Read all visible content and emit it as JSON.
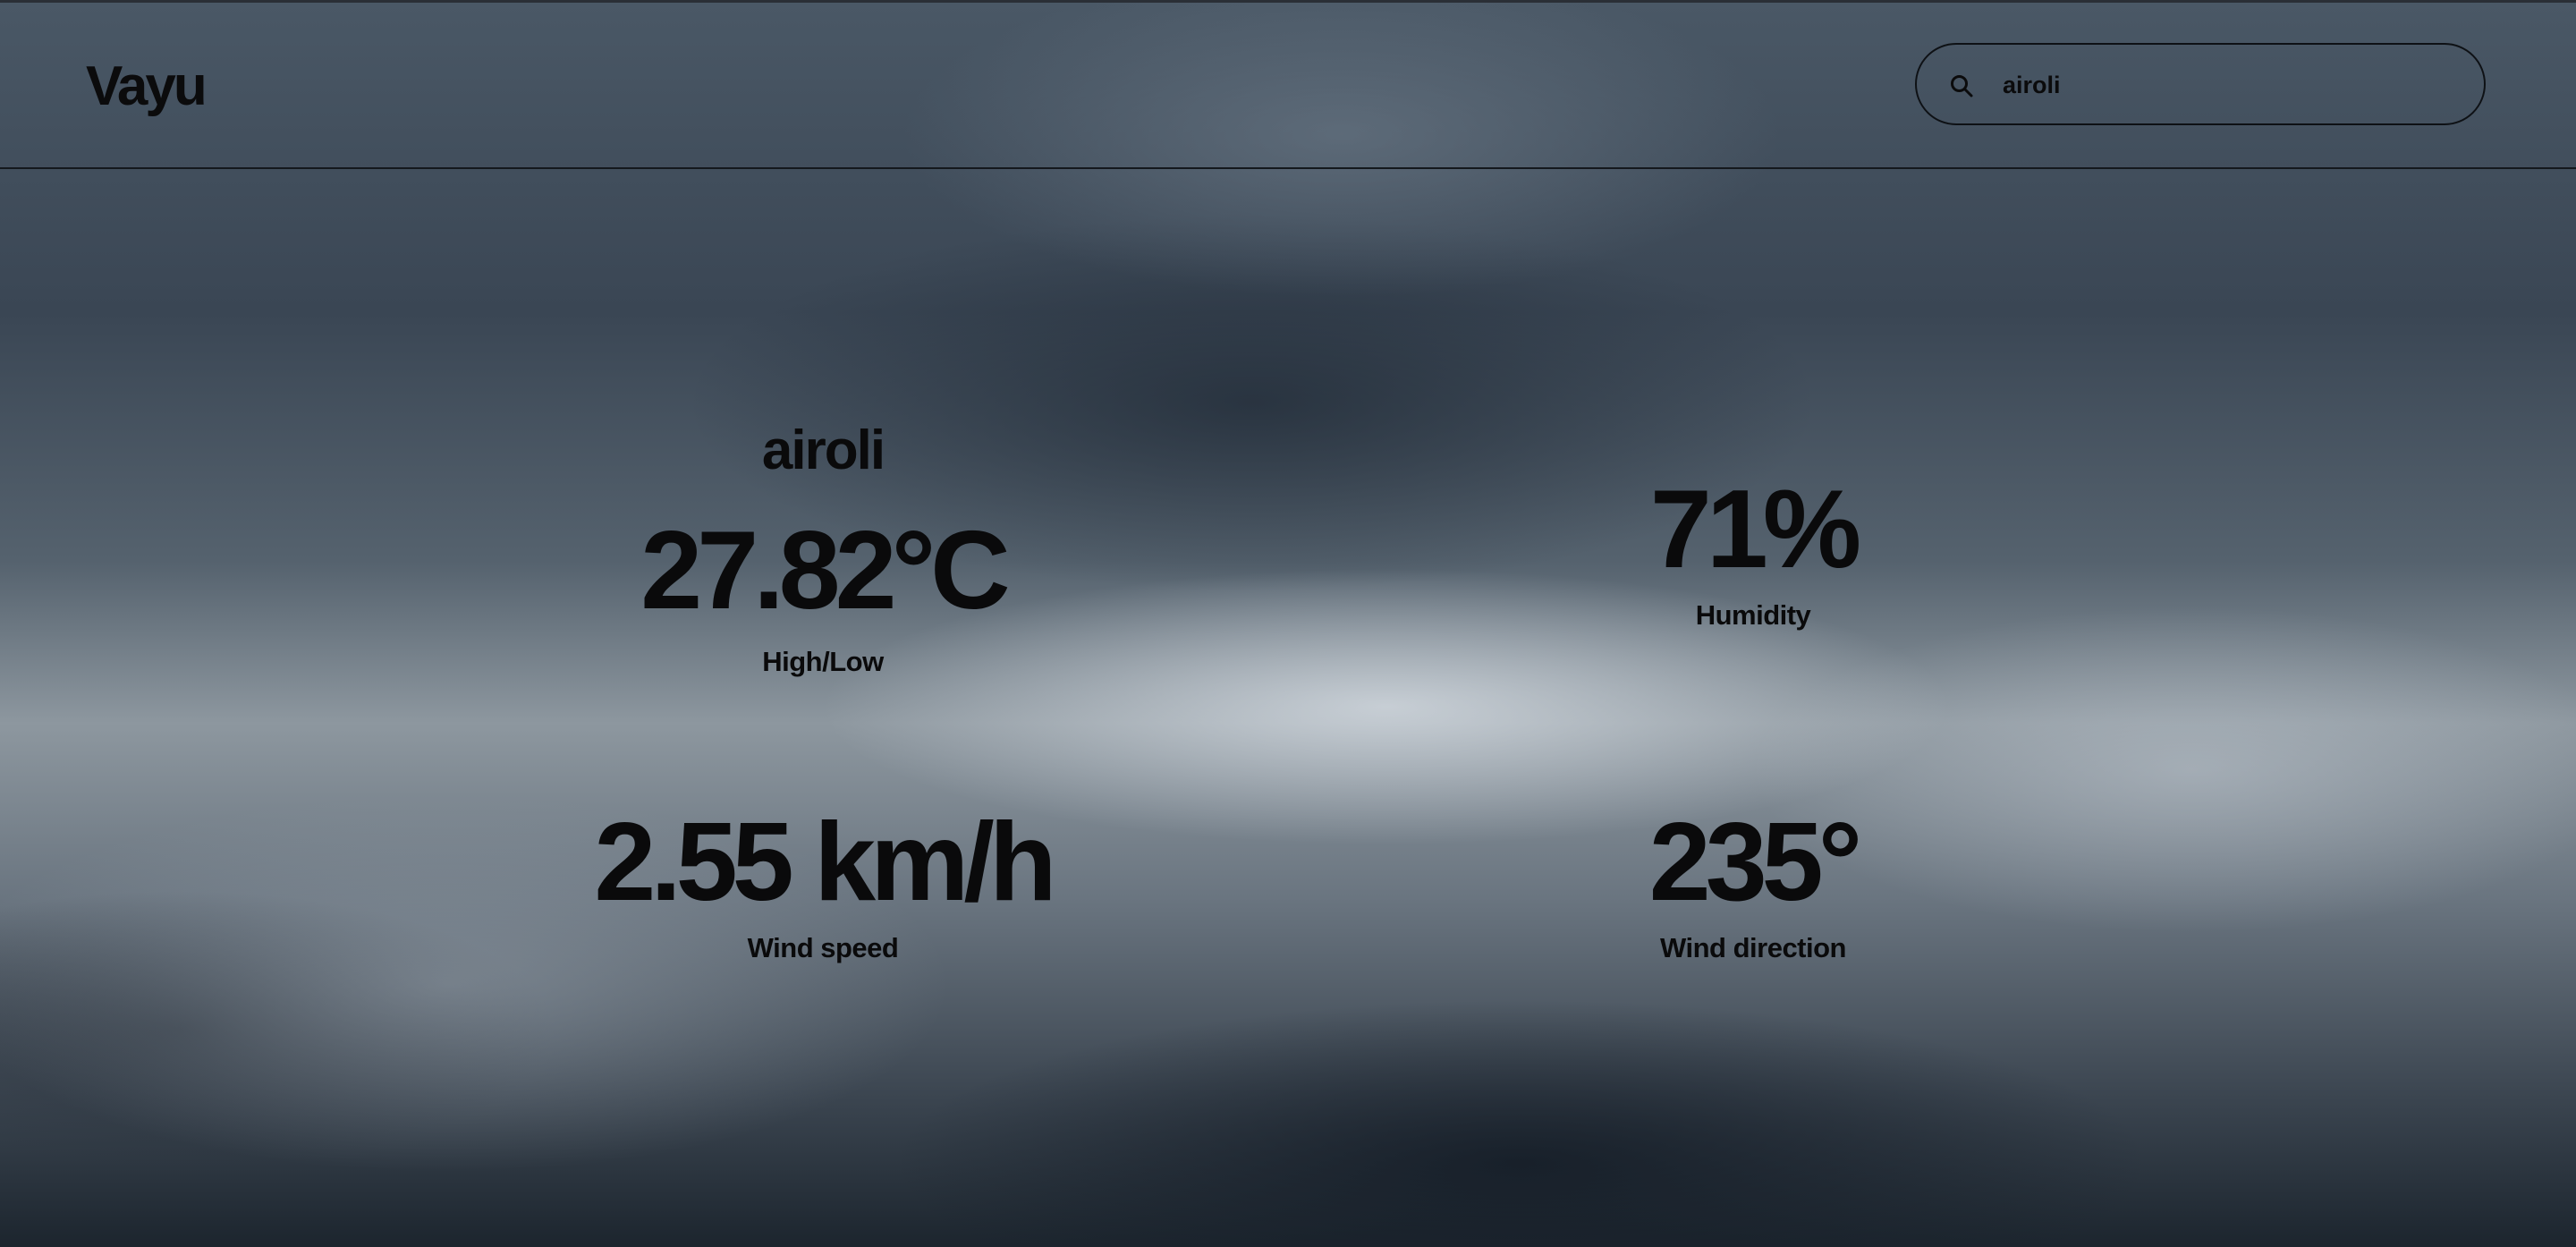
{
  "app": {
    "title": "Vayu"
  },
  "search": {
    "value": "airoli",
    "icon": "search-icon"
  },
  "weather": {
    "city": "airoli",
    "temperature": "27.82°C",
    "temperature_label": "High/Low",
    "humidity": "71%",
    "humidity_label": "Humidity",
    "wind_speed": "2.55 km/h",
    "wind_speed_label": "Wind speed",
    "wind_direction": "235°",
    "wind_direction_label": "Wind direction"
  },
  "colors": {
    "text": "#0a0a0b",
    "spellcheck_underline": "#c62828"
  }
}
